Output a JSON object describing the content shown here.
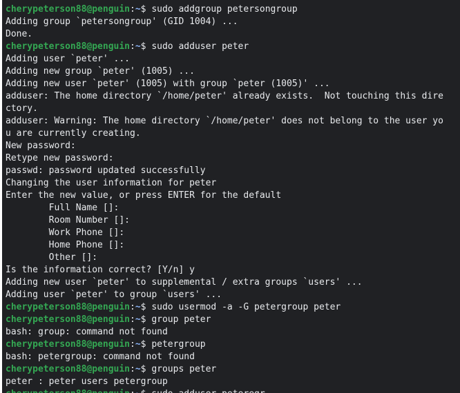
{
  "colors": {
    "background": "#202124",
    "text": "#e8eaed",
    "prompt_user": "#34a853",
    "prompt_path": "#8ab4f8"
  },
  "prompt": {
    "user_host": "cherypeterson88@penguin",
    "separator": ":",
    "path": "~",
    "symbol": "$ "
  },
  "lines": [
    {
      "type": "cmd",
      "text": "sudo addgroup petersongroup"
    },
    {
      "type": "out",
      "text": "Adding group `petersongroup' (GID 1004) ..."
    },
    {
      "type": "out",
      "text": "Done."
    },
    {
      "type": "cmd",
      "text": "sudo adduser peter"
    },
    {
      "type": "out",
      "text": "Adding user `peter' ..."
    },
    {
      "type": "out",
      "text": "Adding new group `peter' (1005) ..."
    },
    {
      "type": "out",
      "text": "Adding new user `peter' (1005) with group `peter (1005)' ..."
    },
    {
      "type": "out",
      "text": "adduser: The home directory `/home/peter' already exists.  Not touching this dire"
    },
    {
      "type": "out",
      "text": "ctory."
    },
    {
      "type": "out",
      "text": "adduser: Warning: The home directory `/home/peter' does not belong to the user yo"
    },
    {
      "type": "out",
      "text": "u are currently creating."
    },
    {
      "type": "out",
      "text": "New password:"
    },
    {
      "type": "out",
      "text": "Retype new password:"
    },
    {
      "type": "out",
      "text": "passwd: password updated successfully"
    },
    {
      "type": "out",
      "text": "Changing the user information for peter"
    },
    {
      "type": "out",
      "text": "Enter the new value, or press ENTER for the default"
    },
    {
      "type": "out",
      "text": "        Full Name []:"
    },
    {
      "type": "out",
      "text": "        Room Number []:"
    },
    {
      "type": "out",
      "text": "        Work Phone []:"
    },
    {
      "type": "out",
      "text": "        Home Phone []:"
    },
    {
      "type": "out",
      "text": "        Other []:"
    },
    {
      "type": "out",
      "text": "Is the information correct? [Y/n] y"
    },
    {
      "type": "out",
      "text": "Adding new user `peter' to supplemental / extra groups `users' ..."
    },
    {
      "type": "out",
      "text": "Adding user `peter' to group `users' ..."
    },
    {
      "type": "cmd",
      "text": "sudo usermod -a -G petergroup peter"
    },
    {
      "type": "cmd",
      "text": "group peter"
    },
    {
      "type": "out",
      "text": "bash: group: command not found"
    },
    {
      "type": "cmd",
      "text": "petergroup"
    },
    {
      "type": "out",
      "text": "bash: petergroup: command not found"
    },
    {
      "type": "cmd",
      "text": "groups peter"
    },
    {
      "type": "out",
      "text": "peter : peter users petergroup"
    },
    {
      "type": "cmd",
      "text": "sudo adduser peteregr"
    }
  ]
}
